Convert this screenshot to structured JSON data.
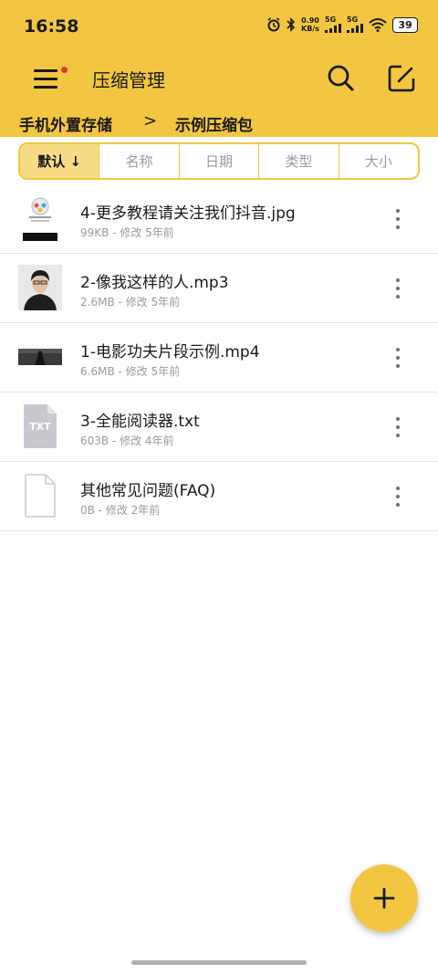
{
  "status_bar": {
    "time": "16:58",
    "net_speed_value": "0.90",
    "net_speed_unit": "KB/s",
    "signal_1": "5G",
    "signal_2": "5G",
    "battery": "39"
  },
  "toolbar": {
    "title": "压缩管理",
    "menu_icon": "menu-icon",
    "search_icon": "search-icon",
    "edit_icon": "edit-icon"
  },
  "breadcrumb": {
    "root": "手机外置存储",
    "separator": ">",
    "current": "示例压缩包"
  },
  "sort_tabs": [
    {
      "label": "默认 ↓",
      "active": true
    },
    {
      "label": "名称",
      "active": false
    },
    {
      "label": "日期",
      "active": false
    },
    {
      "label": "类型",
      "active": false
    },
    {
      "label": "大小",
      "active": false
    }
  ],
  "files": [
    {
      "name": "4-更多教程请关注我们抖音.jpg",
      "meta": "99KB - 修改 5年前",
      "thumb": "image-thumbnail"
    },
    {
      "name": "2-像我这样的人.mp3",
      "meta": "2.6MB - 修改 5年前",
      "thumb": "album-cover-thumbnail"
    },
    {
      "name": "1-电影功夫片段示例.mp4",
      "meta": "6.6MB - 修改 5年前",
      "thumb": "video-thumbnail"
    },
    {
      "name": "3-全能阅读器.txt",
      "meta": "603B - 修改 4年前",
      "thumb": "txt-file-icon",
      "thumb_label": "TXT"
    },
    {
      "name": "其他常见问题(FAQ)",
      "meta": "0B - 修改 2年前",
      "thumb": "blank-file-icon"
    }
  ],
  "fab": {
    "icon": "plus-icon",
    "label": "+"
  },
  "colors": {
    "accent": "#f2c641",
    "active_tab": "#f8dc85",
    "text_primary": "#1a1a1a",
    "text_secondary": "#9a9a9a",
    "divider": "#e3e3e3"
  }
}
